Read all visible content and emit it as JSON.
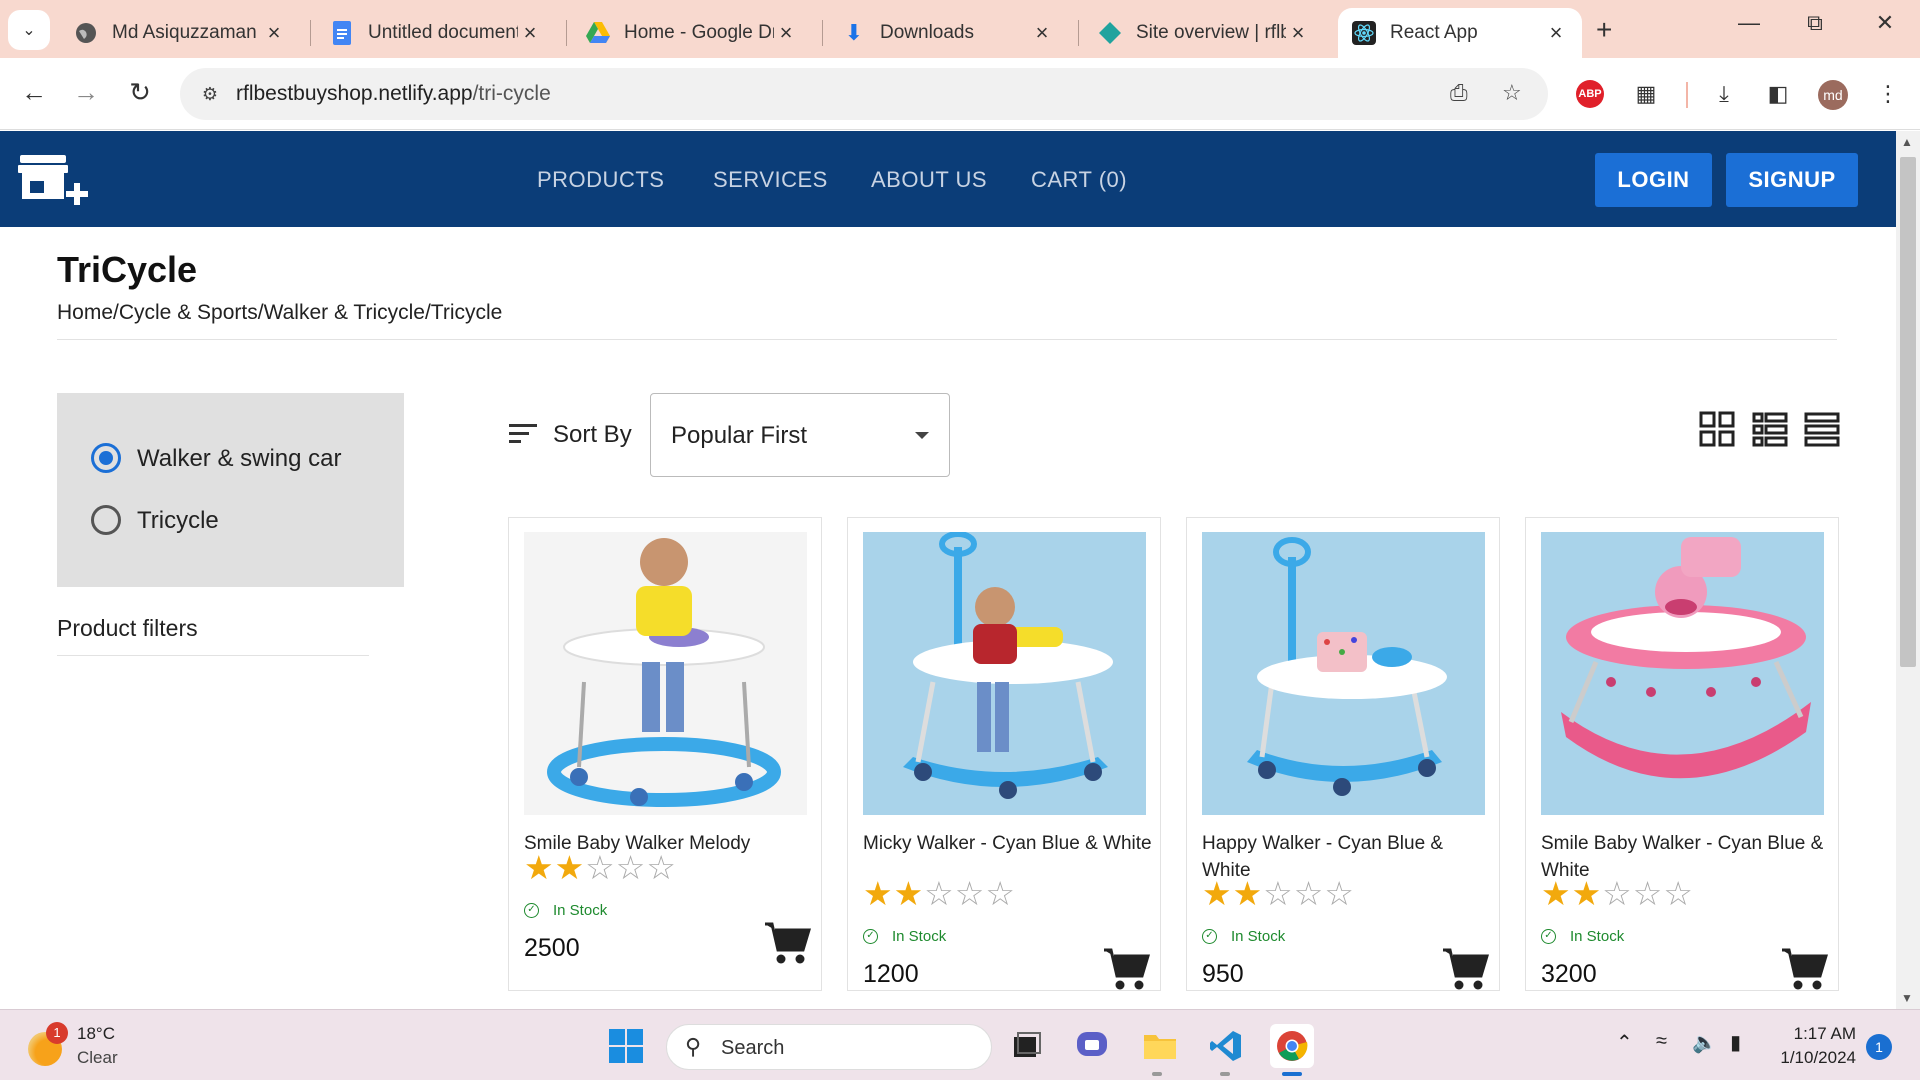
{
  "browser": {
    "tabs": [
      {
        "title": "Md Asiquzzaman",
        "icon": "globe-icon"
      },
      {
        "title": "Untitled document",
        "icon": "docs-icon"
      },
      {
        "title": "Home - Google Dr",
        "icon": "drive-icon"
      },
      {
        "title": "Downloads",
        "icon": "download-icon"
      },
      {
        "title": "Site overview | rflb",
        "icon": "netlify-icon"
      },
      {
        "title": "React App",
        "icon": "react-icon",
        "active": true
      }
    ],
    "url_host": "rflbestbuyshop.netlify.app",
    "url_path": "/tri-cycle",
    "profile_initials": "md",
    "abp_label": "ABP"
  },
  "site": {
    "nav": [
      "PRODUCTS",
      "SERVICES",
      "ABOUT US",
      "CART (0)"
    ],
    "login_label": "LOGIN",
    "signup_label": "SIGNUP",
    "colors": {
      "header": "#0b3d78",
      "button": "#1b6fd6",
      "star": "#f2a90d",
      "stock": "#1e8a2e"
    }
  },
  "page": {
    "title": "TriCycle",
    "breadcrumb": "Home/Cycle & Sports/Walker & Tricycle/Tricycle",
    "filters": [
      {
        "label": "Walker & swing car",
        "selected": true
      },
      {
        "label": "Tricycle",
        "selected": false
      }
    ],
    "filters_title": "Product filters",
    "sort_label": "Sort By",
    "sort_value": "Popular First"
  },
  "products": [
    {
      "name": "Smile Baby Walker Melody",
      "rating": 2,
      "max_rating": 5,
      "stock": "In Stock",
      "price": "2500"
    },
    {
      "name": "Micky Walker - Cyan Blue & White",
      "rating": 2,
      "max_rating": 5,
      "stock": "In Stock",
      "price": "1200"
    },
    {
      "name": "Happy Walker - Cyan Blue & White",
      "rating": 2,
      "max_rating": 5,
      "stock": "In Stock",
      "price": "950"
    },
    {
      "name": "Smile Baby Walker - Cyan Blue & White",
      "rating": 2,
      "max_rating": 5,
      "stock": "In Stock",
      "price": "3200"
    }
  ],
  "taskbar": {
    "weather_temp": "18°C",
    "weather_cond": "Clear",
    "weather_badge": "1",
    "search_label": "Search",
    "time": "1:17 AM",
    "date": "1/10/2024",
    "notifications": "1"
  }
}
